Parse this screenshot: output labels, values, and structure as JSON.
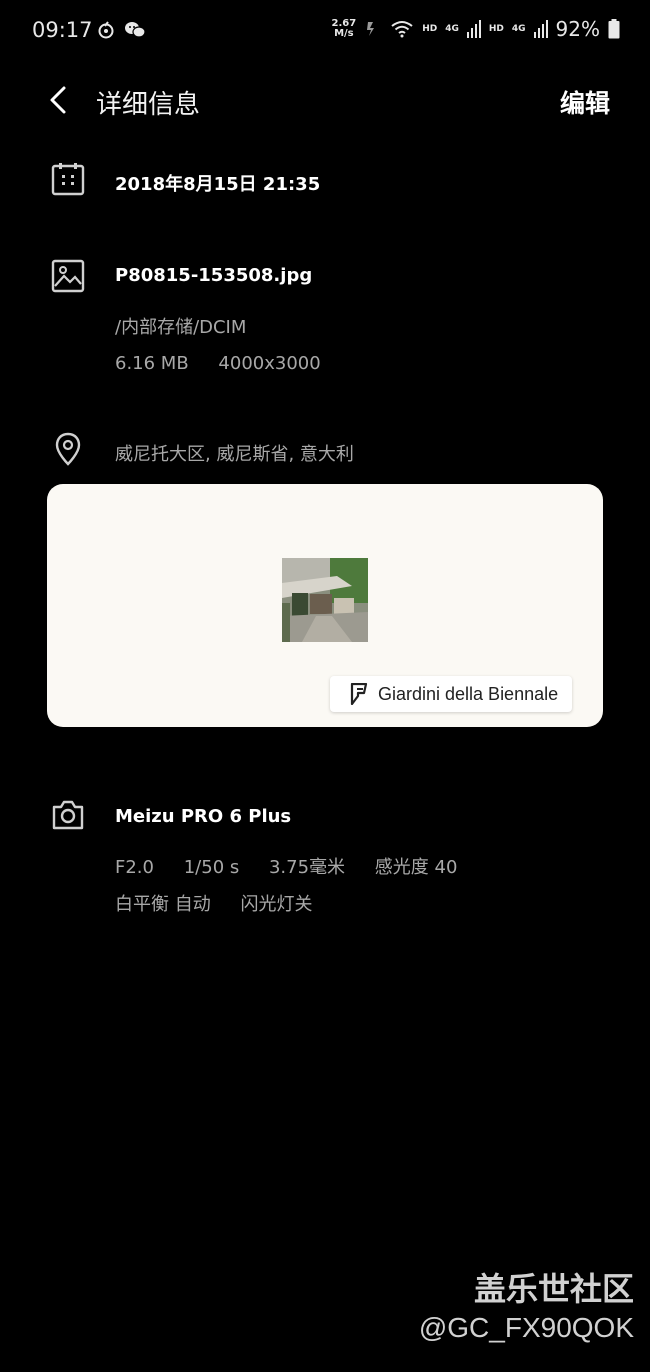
{
  "status_bar": {
    "time": "09:17",
    "net_speed_value": "2.67",
    "net_speed_unit": "M/s",
    "hd1": "HD",
    "net1": "4G",
    "hd2": "HD",
    "net2": "4G",
    "battery": "92%"
  },
  "header": {
    "title": "详细信息",
    "edit_label": "编辑"
  },
  "datetime": "2018年8月15日 21:35",
  "file": {
    "name": "P80815-153508.jpg",
    "path": "/内部存储/DCIM",
    "size": "6.16 MB",
    "resolution": "4000x3000"
  },
  "location": {
    "address": "威尼托大区, 威尼斯省, 意大利",
    "place_name": "Giardini della Biennale"
  },
  "camera": {
    "model": "Meizu PRO 6 Plus",
    "aperture": "F2.0",
    "shutter": "1/50 s",
    "focal_length": "3.75毫米",
    "iso": "感光度 40",
    "white_balance": "白平衡 自动",
    "flash": "闪光灯关"
  },
  "watermark": {
    "line1": "盖乐世社区",
    "line2": "@GC_FX90QOK"
  },
  "icons": {
    "calendar": "calendar-icon",
    "image": "image-icon",
    "location": "location-pin-icon",
    "camera": "camera-icon",
    "foursquare": "foursquare-icon",
    "back": "back-arrow-icon"
  }
}
